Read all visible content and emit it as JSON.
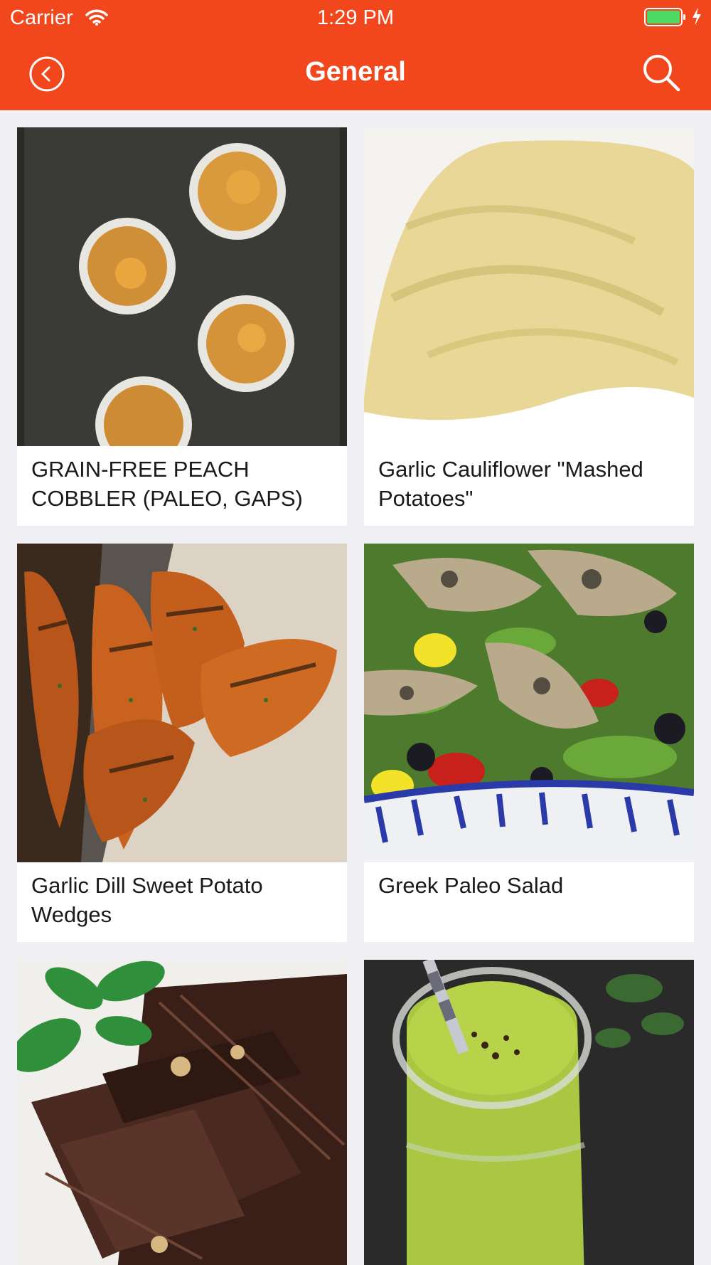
{
  "status_bar": {
    "carrier": "Carrier",
    "time": "1:29 PM"
  },
  "nav": {
    "title": "General",
    "back_icon": "chevron-left-circle-icon",
    "search_icon": "search-icon"
  },
  "colors": {
    "brand": "#f2461c",
    "background": "#efeff4",
    "card": "#ffffff",
    "battery": "#4cd964"
  },
  "recipes": [
    {
      "title": "GRAIN-FREE PEACH COBBLER (PALEO, GAPS)",
      "image": "peach-cobbler-photo"
    },
    {
      "title": "Garlic Cauliflower \"Mashed Potatoes\"",
      "image": "mashed-cauliflower-photo"
    },
    {
      "title": "Garlic Dill Sweet Potato Wedges",
      "image": "sweet-potato-wedges-photo"
    },
    {
      "title": "Greek Paleo Salad",
      "image": "greek-salad-photo"
    },
    {
      "title": "",
      "image": "mint-chocolate-photo"
    },
    {
      "title": "",
      "image": "green-smoothie-photo"
    }
  ]
}
